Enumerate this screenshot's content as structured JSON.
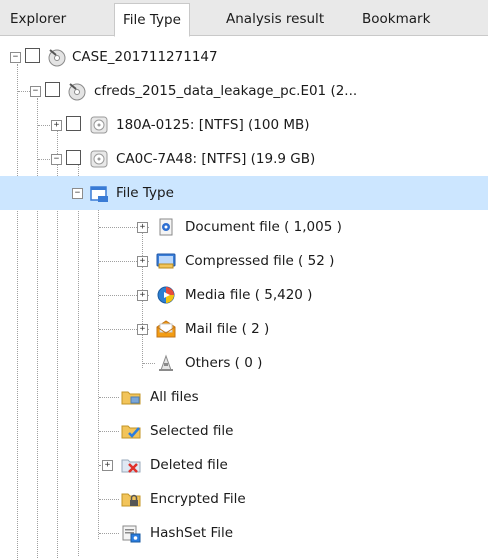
{
  "tabs": [
    "Explorer",
    "File Type",
    "Analysis result",
    "Bookmark"
  ],
  "tree": {
    "case": "CASE_201711271147",
    "image": "cfreds_2015_data_leakage_pc.E01 (2...",
    "volume1": "180A-0125: [NTFS] (100 MB)",
    "volume2": "CA0C-7A48: [NTFS] (19.9 GB)",
    "file_type": "File Type",
    "document": "Document file ( 1,005 )",
    "compressed": "Compressed file ( 52 )",
    "media": "Media file ( 5,420 )",
    "mail": "Mail file ( 2 )",
    "others": "Others ( 0 )",
    "all_files": "All files",
    "selected_file": "Selected file",
    "deleted_file": "Deleted file",
    "encrypted_file": "Encrypted File",
    "hashset_file": "HashSet File"
  },
  "toggles": {
    "plus": "+",
    "minus": "−"
  },
  "colors": {
    "selection": "#cce6ff",
    "tab_strip": "#e9e9e9",
    "folder": "#f2c45a"
  }
}
